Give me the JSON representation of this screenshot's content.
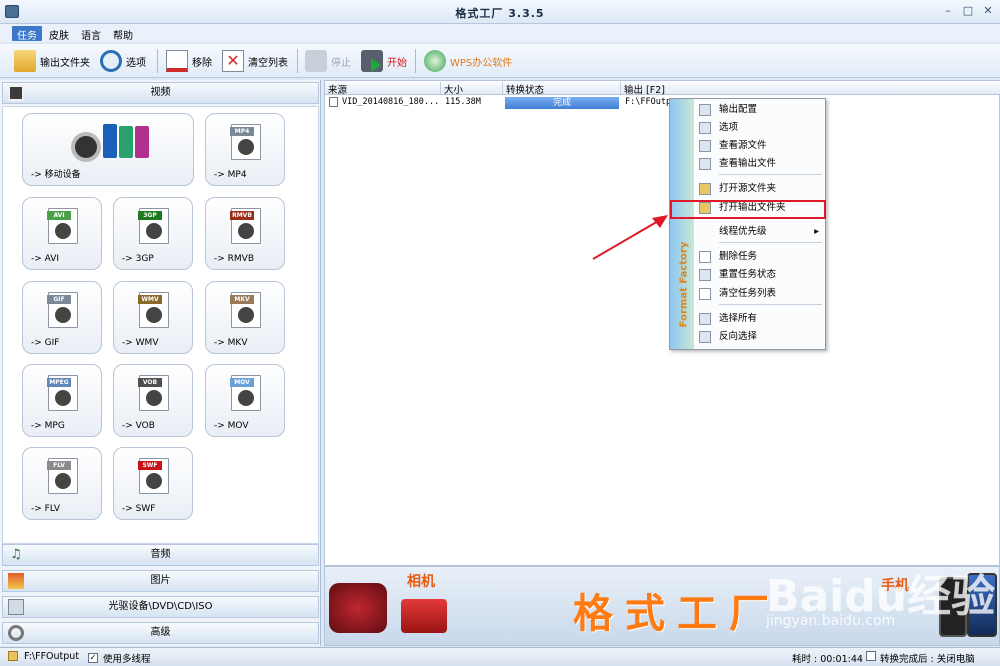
{
  "window": {
    "title": "格式工厂  3.3.5"
  },
  "menu": [
    "任务",
    "皮肤",
    "语言",
    "帮助"
  ],
  "toolbar": {
    "output_folder": "输出文件夹",
    "options": "选项",
    "remove": "移除",
    "clear_list": "清空列表",
    "stop": "停止",
    "start": "开始",
    "wps": "WPS办公软件"
  },
  "categories": {
    "video": "视频",
    "audio": "音频",
    "picture": "图片",
    "rom": "光驱设备\\DVD\\CD\\ISO",
    "advanced": "高级"
  },
  "video_tiles": [
    {
      "label": "-> 移动设备",
      "icon": "mobile-devices-icon"
    },
    {
      "label": "-> MP4",
      "tag": "MP4",
      "icon": "mp4-file-icon"
    },
    {
      "label": "-> AVI",
      "tag": "AVI",
      "icon": "avi-file-icon"
    },
    {
      "label": "-> 3GP",
      "tag": "3GP",
      "icon": "3gp-file-icon"
    },
    {
      "label": "-> RMVB",
      "tag": "RMVB",
      "icon": "rmvb-file-icon"
    },
    {
      "label": "-> GIF",
      "tag": "GIF",
      "icon": "gif-file-icon"
    },
    {
      "label": "-> WMV",
      "tag": "WMV",
      "icon": "wmv-file-icon"
    },
    {
      "label": "-> MKV",
      "tag": "MKV",
      "icon": "mkv-file-icon"
    },
    {
      "label": "-> MPG",
      "tag": "MPEG",
      "icon": "mpg-file-icon"
    },
    {
      "label": "-> VOB",
      "tag": "VOB",
      "icon": "vob-file-icon"
    },
    {
      "label": "-> MOV",
      "tag": "MOV",
      "icon": "mov-file-icon"
    },
    {
      "label": "-> FLV",
      "tag": "FLV",
      "icon": "flv-file-icon"
    },
    {
      "label": "-> SWF",
      "tag": "SWF",
      "icon": "swf-file-icon"
    }
  ],
  "table": {
    "headers": [
      "来源",
      "大小",
      "转换状态",
      "输出 [F2]"
    ],
    "rows": [
      {
        "source": "VID_20140816_180...",
        "size": "115.38M",
        "status": "完成",
        "output": "F:\\FFOutp"
      }
    ]
  },
  "context_menu": {
    "brand": "Format Factory",
    "items": [
      "输出配置",
      "选项",
      "查看源文件",
      "查看输出文件",
      "打开源文件夹",
      "打开输出文件夹",
      "线程优先级",
      "删除任务",
      "重置任务状态",
      "清空任务列表",
      "选择所有",
      "反向选择"
    ]
  },
  "banner": {
    "big_title": "格式工厂",
    "camera": "相机",
    "phone": "手机"
  },
  "watermark": {
    "logo": "Baidu经验",
    "url": "jingyan.baidu.com"
  },
  "statusbar": {
    "path": "F:\\FFOutput",
    "multithread": "使用多线程",
    "elapsed": "耗时 : 00:01:44",
    "after_done": "转换完成后 : 关闭电脑"
  },
  "colors": {
    "accent": "#3c78c9",
    "progress": "#4a86d8",
    "highlight": "#e0192a",
    "brand_orange": "#ff7a10"
  }
}
